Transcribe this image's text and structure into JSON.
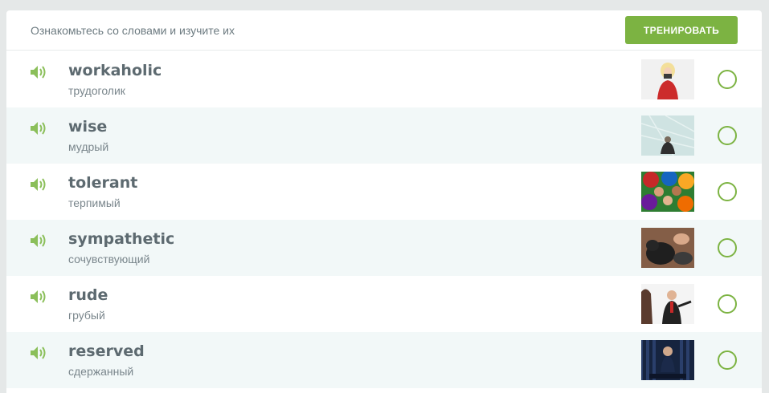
{
  "header": {
    "title": "Ознакомьтесь со словами и изучите их",
    "train_label": "ТРЕНИРОВАТЬ"
  },
  "colors": {
    "accent": "#7cb342",
    "alt_row": "#f2f8f8"
  },
  "words": [
    {
      "word": "workaholic",
      "translation": "трудоголик",
      "learned": false
    },
    {
      "word": "wise",
      "translation": "мудрый",
      "learned": false
    },
    {
      "word": "tolerant",
      "translation": "терпимый",
      "learned": false
    },
    {
      "word": "sympathetic",
      "translation": "сочувствующий",
      "learned": false
    },
    {
      "word": "rude",
      "translation": "грубый",
      "learned": false
    },
    {
      "word": "reserved",
      "translation": "сдержанный",
      "learned": false
    }
  ]
}
